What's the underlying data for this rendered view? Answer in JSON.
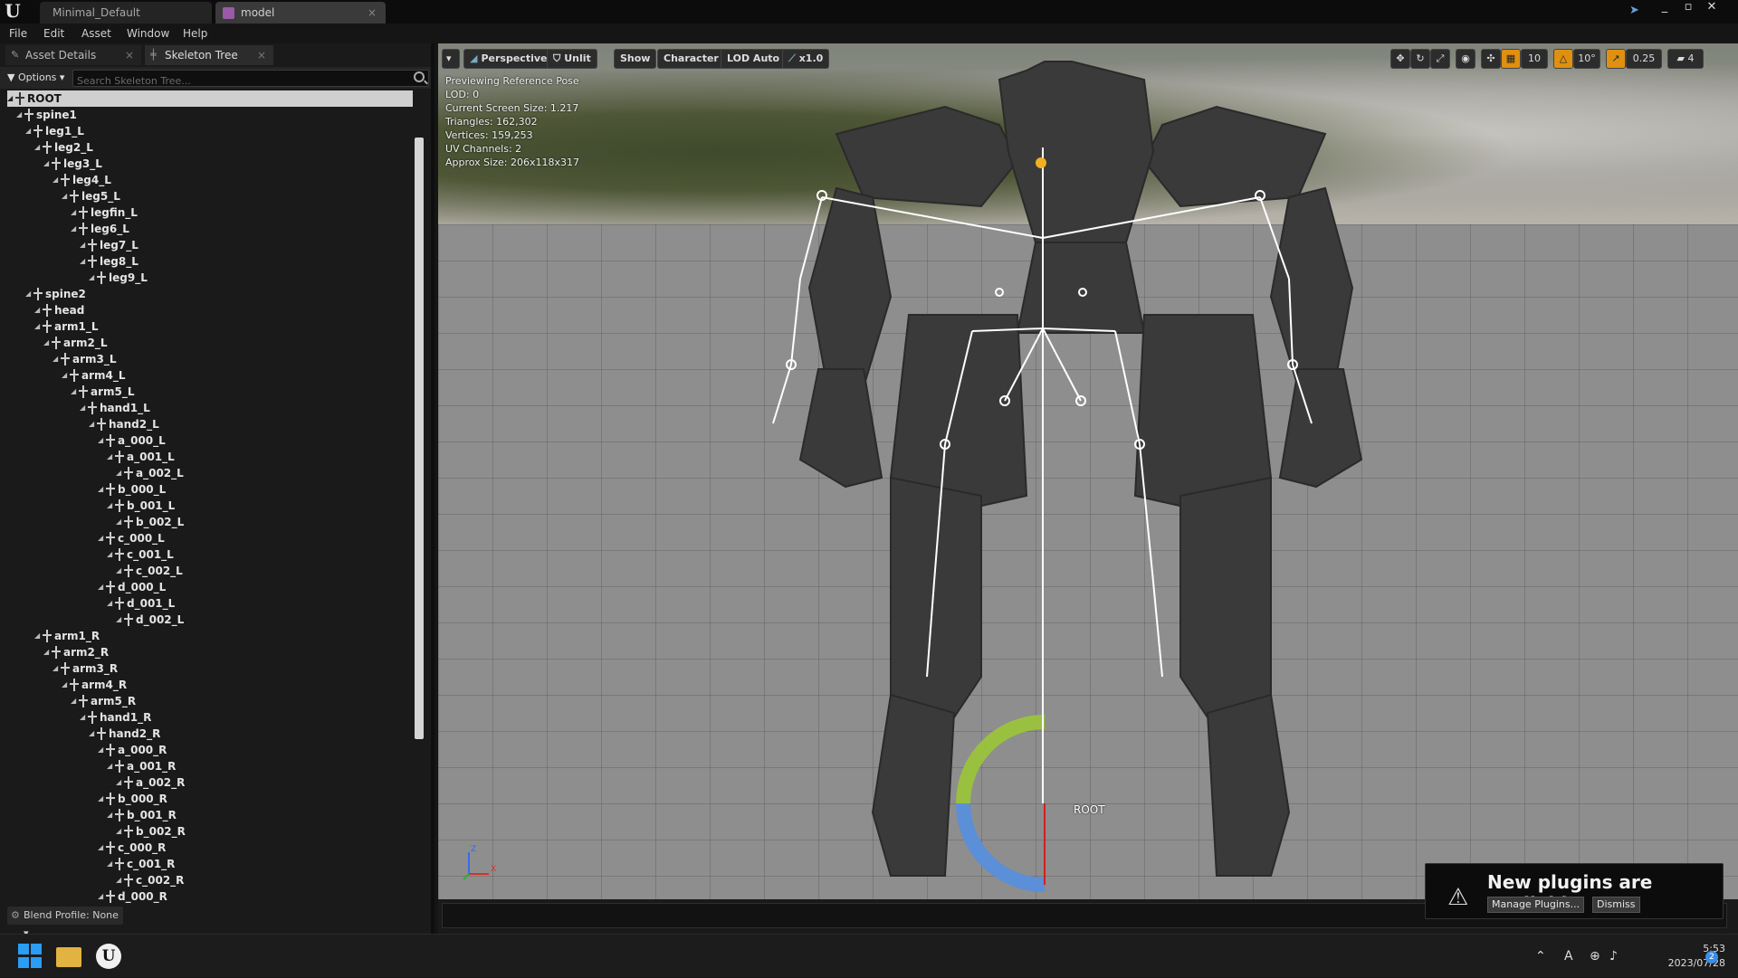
{
  "titlebar": {
    "tabs": [
      {
        "label": "Minimal_Default"
      },
      {
        "label": "model"
      }
    ],
    "close_glyph": "×",
    "window_controls": [
      "_",
      "▫",
      "✕"
    ]
  },
  "menu": [
    "File",
    "Edit",
    "Asset",
    "Window",
    "Help"
  ],
  "left_panel": {
    "tabs": [
      {
        "label": "Asset Details"
      },
      {
        "label": "Skeleton Tree"
      }
    ],
    "options_label": "Options",
    "search_placeholder": "Search Skeleton Tree...",
    "bones": [
      {
        "name": "ROOT",
        "depth": 0,
        "selected": true
      },
      {
        "name": "spine1",
        "depth": 1
      },
      {
        "name": "leg1_L",
        "depth": 2
      },
      {
        "name": "leg2_L",
        "depth": 3
      },
      {
        "name": "leg3_L",
        "depth": 4
      },
      {
        "name": "leg4_L",
        "depth": 5
      },
      {
        "name": "leg5_L",
        "depth": 6
      },
      {
        "name": "legfin_L",
        "depth": 7
      },
      {
        "name": "leg6_L",
        "depth": 7
      },
      {
        "name": "leg7_L",
        "depth": 8
      },
      {
        "name": "leg8_L",
        "depth": 8
      },
      {
        "name": "leg9_L",
        "depth": 9
      },
      {
        "name": "spine2",
        "depth": 2
      },
      {
        "name": "head",
        "depth": 3
      },
      {
        "name": "arm1_L",
        "depth": 3
      },
      {
        "name": "arm2_L",
        "depth": 4
      },
      {
        "name": "arm3_L",
        "depth": 5
      },
      {
        "name": "arm4_L",
        "depth": 6
      },
      {
        "name": "arm5_L",
        "depth": 7
      },
      {
        "name": "hand1_L",
        "depth": 8
      },
      {
        "name": "hand2_L",
        "depth": 9
      },
      {
        "name": "a_000_L",
        "depth": 10
      },
      {
        "name": "a_001_L",
        "depth": 11
      },
      {
        "name": "a_002_L",
        "depth": 12
      },
      {
        "name": "b_000_L",
        "depth": 10
      },
      {
        "name": "b_001_L",
        "depth": 11
      },
      {
        "name": "b_002_L",
        "depth": 12
      },
      {
        "name": "c_000_L",
        "depth": 10
      },
      {
        "name": "c_001_L",
        "depth": 11
      },
      {
        "name": "c_002_L",
        "depth": 12
      },
      {
        "name": "d_000_L",
        "depth": 10
      },
      {
        "name": "d_001_L",
        "depth": 11
      },
      {
        "name": "d_002_L",
        "depth": 12
      },
      {
        "name": "arm1_R",
        "depth": 3
      },
      {
        "name": "arm2_R",
        "depth": 4
      },
      {
        "name": "arm3_R",
        "depth": 5
      },
      {
        "name": "arm4_R",
        "depth": 6
      },
      {
        "name": "arm5_R",
        "depth": 7
      },
      {
        "name": "hand1_R",
        "depth": 8
      },
      {
        "name": "hand2_R",
        "depth": 9
      },
      {
        "name": "a_000_R",
        "depth": 10
      },
      {
        "name": "a_001_R",
        "depth": 11
      },
      {
        "name": "a_002_R",
        "depth": 12
      },
      {
        "name": "b_000_R",
        "depth": 10
      },
      {
        "name": "b_001_R",
        "depth": 11
      },
      {
        "name": "b_002_R",
        "depth": 12
      },
      {
        "name": "c_000_R",
        "depth": 10
      },
      {
        "name": "c_001_R",
        "depth": 11
      },
      {
        "name": "c_002_R",
        "depth": 12
      },
      {
        "name": "d_000_R",
        "depth": 10
      }
    ],
    "blend_profile": "Blend Profile: None"
  },
  "viewport": {
    "toolbar": {
      "perspective": "Perspective",
      "unlit": "Unlit",
      "show": "Show",
      "character": "Character",
      "lod": "LOD Auto",
      "speed": "x1.0"
    },
    "right_toolbar": {
      "grid_snap": "10",
      "rot_snap": "10°",
      "scale_snap": "0.25",
      "camera_speed": "4"
    },
    "info": [
      "Previewing Reference Pose",
      "LOD: 0",
      "Current Screen Size: 1.217",
      "Triangles: 162,302",
      "Vertices: 159,253",
      "UV Channels: 2",
      "Approx Size: 206x118x317"
    ],
    "root_label": "ROOT",
    "axis": {
      "z": "Z",
      "x": "X"
    }
  },
  "notification": {
    "title": "New plugins are available",
    "manage": "Manage Plugins...",
    "dismiss": "Dismiss"
  },
  "taskbar": {
    "time": "5:53",
    "date": "2023/07/28",
    "badge": "2",
    "ime": "A"
  }
}
